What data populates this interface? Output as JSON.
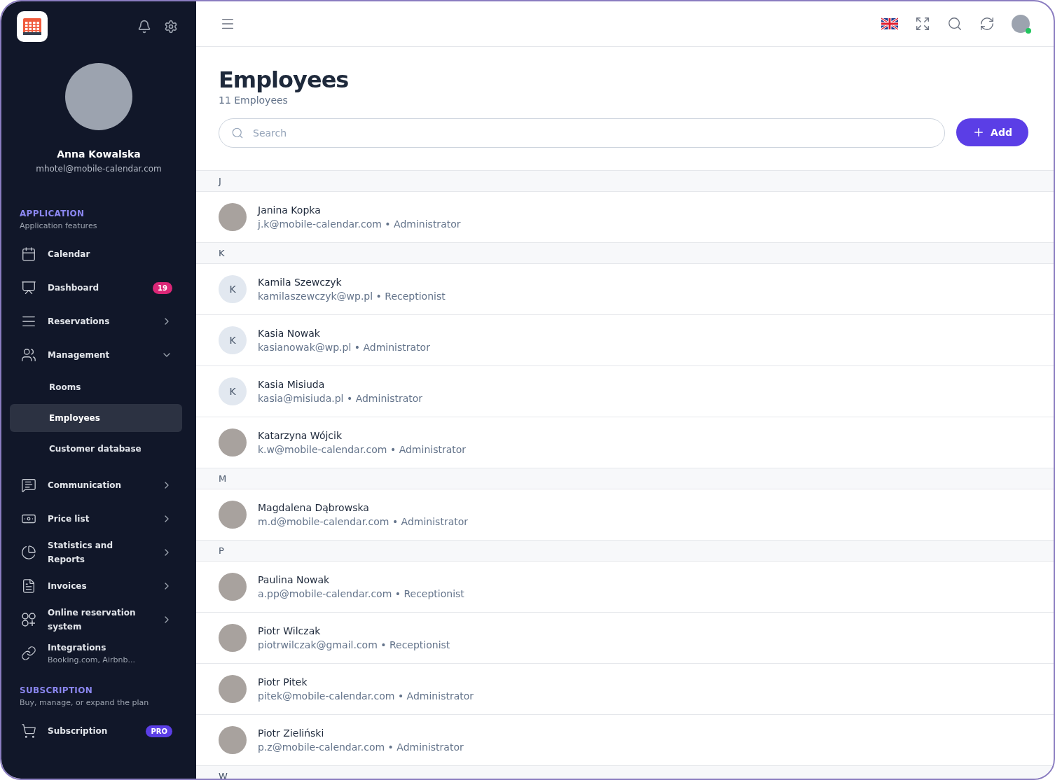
{
  "sidebar": {
    "user": {
      "name": "Anna Kowalska",
      "email": "mhotel@mobile-calendar.com"
    },
    "sections": [
      {
        "title": "APPLICATION",
        "subtitle": "Application features",
        "items": [
          {
            "label": "Calendar",
            "selected": false
          },
          {
            "label": "Dashboard",
            "selected": false,
            "badge": {
              "text": "19",
              "color": "#db2777"
            }
          },
          {
            "label": "Reservations",
            "selected": false,
            "expanded": false
          },
          {
            "label": "Management",
            "selected": false,
            "expanded": true,
            "children": [
              {
                "label": "Rooms",
                "selected": false
              },
              {
                "label": "Employees",
                "selected": true
              },
              {
                "label": "Customer database",
                "selected": false
              }
            ]
          },
          {
            "label": "Communication",
            "selected": false,
            "expanded": false
          },
          {
            "label": "Price list",
            "selected": false,
            "expanded": false
          },
          {
            "label": "Statistics and Reports",
            "selected": false,
            "expanded": false
          },
          {
            "label": "Invoices",
            "selected": false,
            "expanded": false
          },
          {
            "label": "Online reservation system",
            "selected": false,
            "expanded": false
          },
          {
            "label": "Integrations",
            "sublabel": "Booking.com, Airbnb...",
            "selected": false
          }
        ]
      },
      {
        "title": "SUBSCRIPTION",
        "subtitle": "Buy, manage, or expand the plan",
        "items": [
          {
            "label": "Subscription",
            "selected": false,
            "badge": {
              "text": "PRO",
              "color": "#5b3ee6"
            }
          }
        ]
      }
    ]
  },
  "topbar": {
    "avatar": {
      "online": true
    }
  },
  "page": {
    "title": "Employees",
    "count": "11 Employees",
    "search": {
      "placeholder": "Search"
    },
    "add_button": "Add"
  },
  "groups": [
    {
      "letter": "J",
      "employees": [
        {
          "name": "Janina Kopka",
          "detail": "j.k@mobile-calendar.com • Administrator",
          "avatar": {
            "kind": "photo"
          }
        }
      ]
    },
    {
      "letter": "K",
      "employees": [
        {
          "name": "Kamila Szewczyk",
          "detail": "kamilaszewczyk@wp.pl • Receptionist",
          "avatar": {
            "kind": "initial",
            "initial": "K"
          }
        },
        {
          "name": "Kasia Nowak",
          "detail": "kasianowak@wp.pl • Administrator",
          "avatar": {
            "kind": "initial",
            "initial": "K"
          }
        },
        {
          "name": "Kasia Misiuda",
          "detail": "kasia@misiuda.pl • Administrator",
          "avatar": {
            "kind": "initial",
            "initial": "K"
          }
        },
        {
          "name": "Katarzyna Wójcik",
          "detail": "k.w@mobile-calendar.com • Administrator",
          "avatar": {
            "kind": "photo"
          }
        }
      ]
    },
    {
      "letter": "M",
      "employees": [
        {
          "name": "Magdalena Dąbrowska",
          "detail": "m.d@mobile-calendar.com • Administrator",
          "avatar": {
            "kind": "photo"
          }
        }
      ]
    },
    {
      "letter": "P",
      "employees": [
        {
          "name": "Paulina Nowak",
          "detail": "a.pp@mobile-calendar.com • Receptionist",
          "avatar": {
            "kind": "photo"
          }
        },
        {
          "name": "Piotr Wilczak",
          "detail": "piotrwilczak@gmail.com • Receptionist",
          "avatar": {
            "kind": "photo"
          }
        },
        {
          "name": "Piotr Pitek",
          "detail": "pitek@mobile-calendar.com • Administrator",
          "avatar": {
            "kind": "photo"
          }
        },
        {
          "name": "Piotr Zieliński",
          "detail": "p.z@mobile-calendar.com • Administrator",
          "avatar": {
            "kind": "photo"
          }
        }
      ]
    },
    {
      "letter": "W"
    }
  ]
}
